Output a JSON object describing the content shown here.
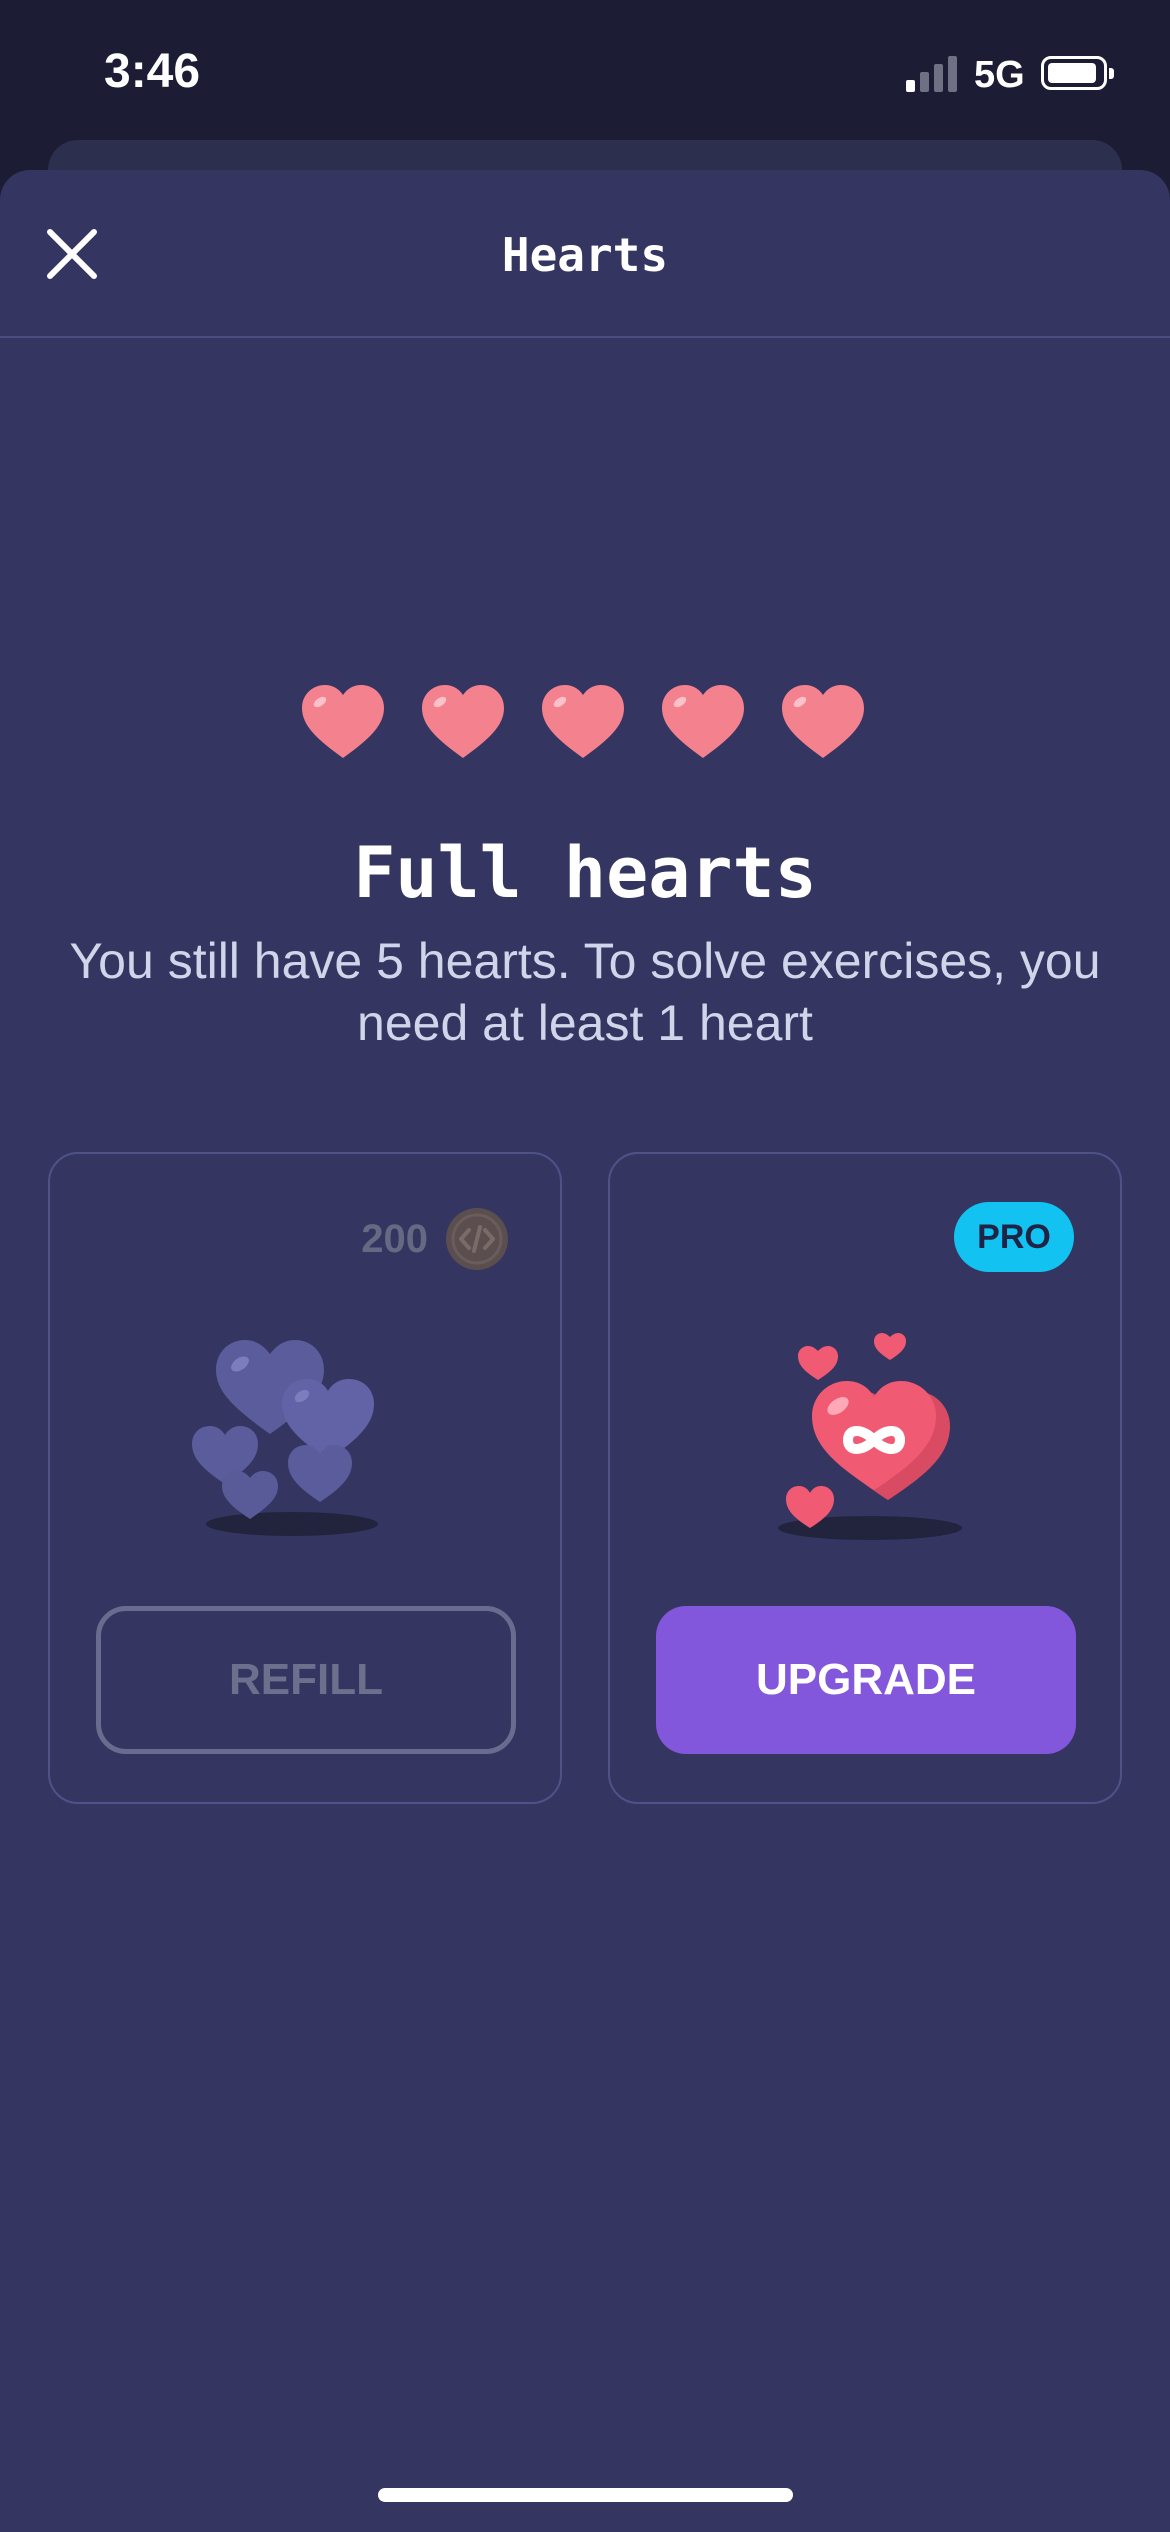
{
  "status_bar": {
    "time": "3:46",
    "network": "5G",
    "signal_bars_active": 1,
    "signal_bars_total": 4,
    "battery_level": 0.85
  },
  "header": {
    "title": "Hearts",
    "close_icon": "close-icon"
  },
  "hearts": {
    "count": 5,
    "color": "#f4818e"
  },
  "main": {
    "title": "Full hearts",
    "subtitle": "You still have 5 hearts. To solve exercises, you need at least 1 heart"
  },
  "refill_card": {
    "price": "200",
    "coin_icon": "code-coin-icon",
    "button_label": "REFILL",
    "illustration": "hearts-pile-illustration"
  },
  "upgrade_card": {
    "badge": "PRO",
    "badge_color": "#12c3f2",
    "button_label": "UPGRADE",
    "button_color": "#8357dc",
    "illustration": "infinite-heart-illustration"
  },
  "colors": {
    "background": "#343661",
    "accent": "#8357dc"
  }
}
